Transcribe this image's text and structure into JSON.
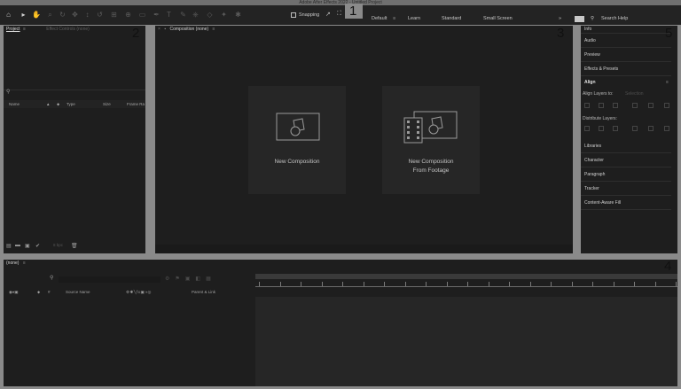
{
  "window": {
    "title": "Adobe After Effects 2022 - Untitled Project"
  },
  "toolbar": {
    "snapping_label": "Snapping",
    "workspaces": [
      "Default",
      "Learn",
      "Standard",
      "Small Screen"
    ],
    "search_label": "Search Help",
    "more_label": "»"
  },
  "callouts": [
    "1",
    "2",
    "3",
    "4",
    "5"
  ],
  "project_panel": {
    "tabs": [
      "Project",
      "Effect Controls (none)"
    ],
    "columns": [
      "Name",
      "Type",
      "Size",
      "Frame Ra"
    ],
    "footer_bpc": "8 bpc"
  },
  "composition_panel": {
    "tab": "Composition (none)",
    "cards": [
      {
        "label_lines": [
          "New Composition"
        ]
      },
      {
        "label_lines": [
          "New Composition",
          "From Footage"
        ]
      }
    ]
  },
  "right_panel": {
    "items": [
      "Info",
      "Audio",
      "Preview",
      "Effects & Presets"
    ],
    "align": {
      "title": "Align",
      "layers_to_label": "Align Layers to:",
      "layers_to_value": "Selection",
      "distribute_label": "Distribute Layers:"
    },
    "items_after": [
      "Libraries",
      "Character",
      "Paragraph",
      "Tracker",
      "Content-Aware Fill"
    ]
  },
  "timeline": {
    "tab": "(none)",
    "columns": [
      "Source Name",
      "Parent & Link"
    ]
  },
  "colors": {
    "panel_bg": "#1e1e1e",
    "frame": "#8a8a8a",
    "toolbar": "#232323"
  }
}
